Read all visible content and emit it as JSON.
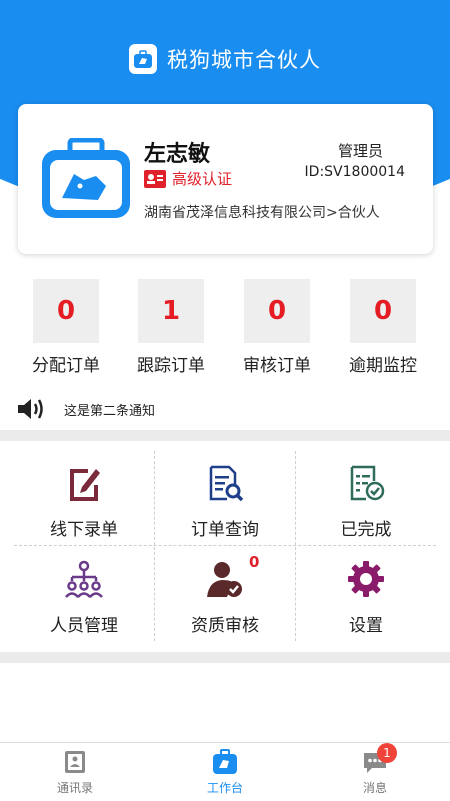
{
  "app": {
    "title": "税狗城市合伙人"
  },
  "profile": {
    "name": "左志敏",
    "certification": "高级认证",
    "role": "管理员",
    "id": "ID:SV1800014",
    "company": "湖南省茂泽信息科技有限公司>合伙人"
  },
  "stats": [
    {
      "value": "0",
      "label": "分配订单"
    },
    {
      "value": "1",
      "label": "跟踪订单"
    },
    {
      "value": "0",
      "label": "审核订单"
    },
    {
      "value": "0",
      "label": "逾期监控"
    }
  ],
  "notice": {
    "text": "这是第二条通知",
    "icon": "speaker-icon"
  },
  "menu": [
    {
      "label": "线下录单",
      "icon": "edit-document-icon",
      "color": "#7a2a3a"
    },
    {
      "label": "订单查询",
      "icon": "document-search-icon",
      "color": "#1f3f8a"
    },
    {
      "label": "已完成",
      "icon": "document-check-icon",
      "color": "#2f6b5b"
    },
    {
      "label": "人员管理",
      "icon": "people-tree-icon",
      "color": "#6a3a8a"
    },
    {
      "label": "资质审核",
      "icon": "user-verify-icon",
      "color": "#5a2a2a",
      "badge": "0"
    },
    {
      "label": "设置",
      "icon": "gear-icon",
      "color": "#8a1a6a"
    }
  ],
  "nav": {
    "contacts": "通讯录",
    "workbench": "工作台",
    "messages": "消息",
    "messages_badge": "1"
  },
  "colors": {
    "primary": "#1a8df0",
    "accent_red": "#e51c23"
  }
}
